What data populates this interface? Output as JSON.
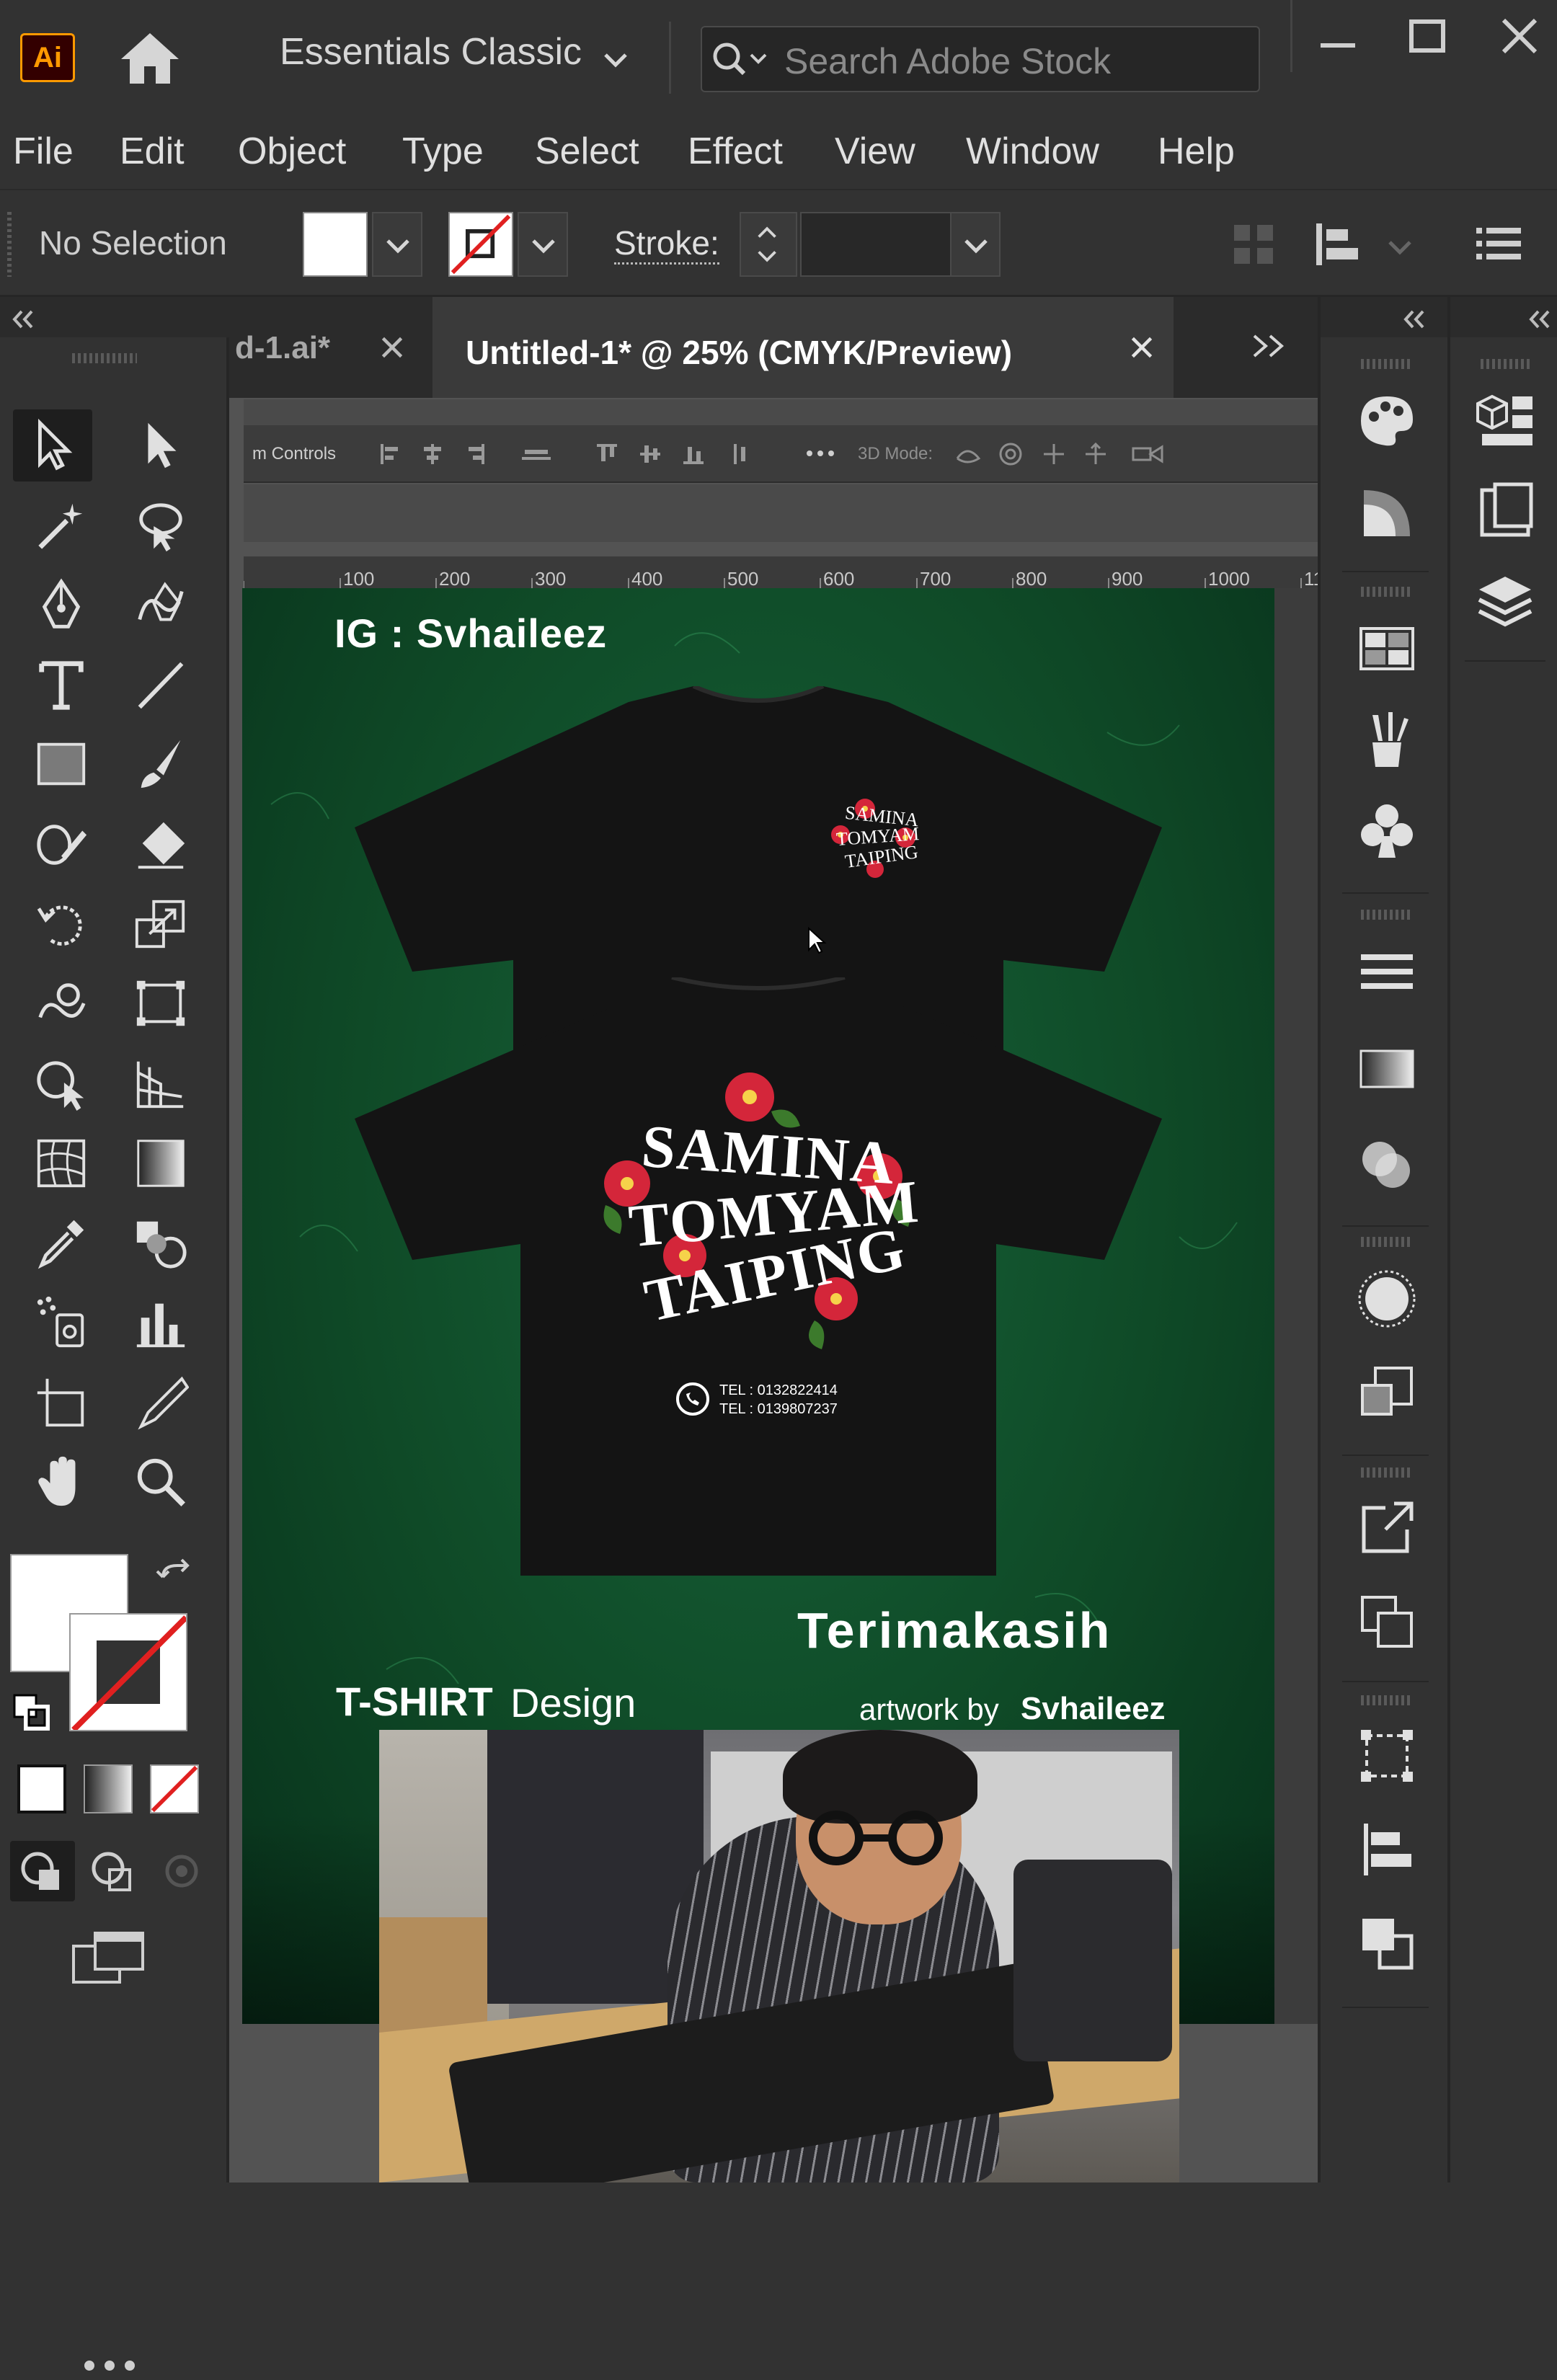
{
  "app": {
    "logo": "Ai",
    "workspace": "Essentials Classic",
    "search_placeholder": "Search Adobe Stock"
  },
  "menu": [
    "File",
    "Edit",
    "Object",
    "Type",
    "Select",
    "Effect",
    "View",
    "Window",
    "Help"
  ],
  "controlbar": {
    "selection": "No Selection",
    "stroke_label": "Stroke:"
  },
  "tabs": {
    "inactive": "d-1.ai*",
    "active": "Untitled-1* @ 25% (CMYK/Preview)"
  },
  "inner_screenshot": {
    "controls_label": "m Controls",
    "mode_label": "3D Mode:"
  },
  "ruler": [
    "100",
    "200",
    "300",
    "400",
    "500",
    "600",
    "700",
    "800",
    "900",
    "1000",
    "11"
  ],
  "artwork": {
    "ig": "IG : Svhaileez",
    "front_print": [
      "SAMINA",
      "TOMYAM",
      "TAIPING"
    ],
    "back_print": [
      "SAMINA",
      "TOMYAM",
      "TAIPING"
    ],
    "tel1": "TEL : 0132822414",
    "tel2": "TEL : 0139807237",
    "thanks": "Terimakasih",
    "tshirt": "T-SHIRT",
    "design": "Design",
    "artwork_by": "artwork by",
    "author": "Svhaileez"
  },
  "colors": {
    "accent": "#ff9a00",
    "canvas_green": "#0f4a27",
    "shirt": "#141414",
    "flower": "#d4263a"
  }
}
